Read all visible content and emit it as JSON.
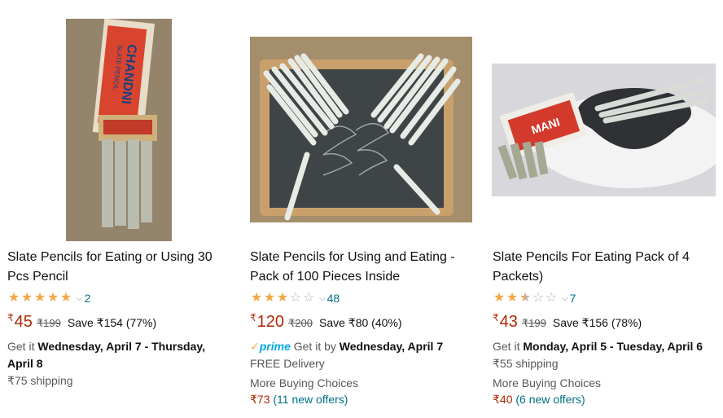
{
  "products": [
    {
      "title": "Slate Pencils for Eating or Using 30 Pcs Pencil",
      "rating": 5,
      "review_count": "2",
      "currency": "₹",
      "price": "45",
      "mrp": "₹199",
      "save": "Save ₹154 (77%)",
      "delivery_prefix": "Get it ",
      "delivery_date": "Wednesday, April 7 - Thursday, April 8",
      "shipping": "₹75 shipping",
      "box_brand": "CHANDNI",
      "box_label": "SLATE PENCIL"
    },
    {
      "title": "Slate Pencils for Using and Eating - Pack of 100 Pieces Inside",
      "rating": 3,
      "review_count": "48",
      "currency": "₹",
      "price": "120",
      "mrp": "₹200",
      "save": "Save ₹80 (40%)",
      "prime_label": "prime",
      "delivery_prefix": " Get it by ",
      "delivery_date": "Wednesday, April 7",
      "free_delivery": "FREE Delivery",
      "more_choices": "More Buying Choices",
      "offer_price": "₹73",
      "offer_link": "(11 new offers)"
    },
    {
      "title": "Slate Pencils For Eating Pack of 4 Packets)",
      "rating": 2.5,
      "review_count": "7",
      "currency": "₹",
      "price": "43",
      "mrp": "₹199",
      "save": "Save ₹156 (78%)",
      "delivery_prefix": "Get it ",
      "delivery_date": "Monday, April 5 - Tuesday, April 6",
      "shipping": "₹55 shipping",
      "more_choices": "More Buying Choices",
      "offer_price": "₹40",
      "offer_link": "(6 new offers)",
      "box_brand": "MANI"
    }
  ],
  "colors": {
    "price": "#b12704",
    "star": "#f3a847",
    "link": "#007185",
    "prime": "#00a8e1"
  }
}
